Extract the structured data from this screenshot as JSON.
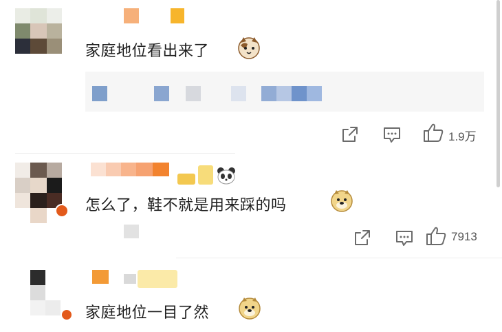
{
  "comments": [
    {
      "text": "家庭地位看出来了",
      "emoji": "cat-emoji",
      "actions": {
        "share_icon": "share-icon",
        "reply_icon": "comment-icon",
        "like_icon": "like-icon",
        "likes": "1.9万"
      }
    },
    {
      "text": "怎么了，鞋不就是用来踩的吗",
      "emoji": "doge-emoji",
      "actions": {
        "share_icon": "share-icon",
        "reply_icon": "comment-icon",
        "like_icon": "like-icon",
        "likes": "7913"
      }
    },
    {
      "text": "家庭地位一目了然",
      "emoji": "doge-emoji"
    }
  ],
  "colors": {
    "text": "#1f1f1f",
    "count": "#555555",
    "icon": "#6b6b6b",
    "quote_bg": "#f6f6f6"
  }
}
